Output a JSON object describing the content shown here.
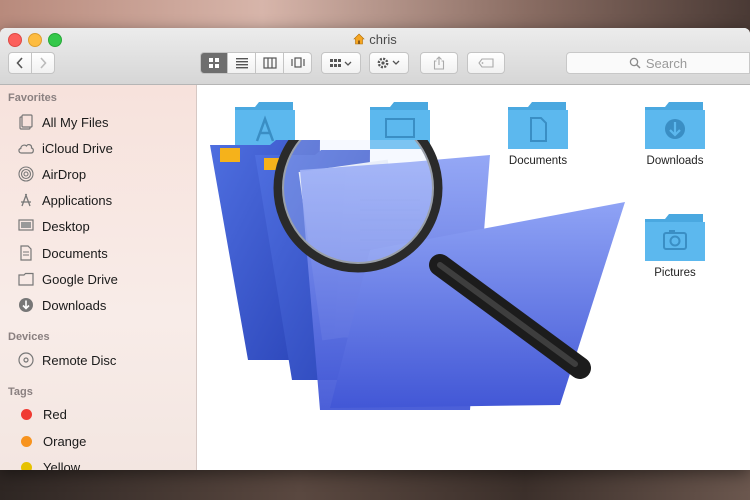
{
  "window": {
    "title": "chris"
  },
  "toolbar": {
    "search_placeholder": "Search"
  },
  "sidebar": {
    "sections": [
      {
        "header": "Favorites",
        "items": [
          {
            "label": "All My Files",
            "icon": "all-files-icon"
          },
          {
            "label": "iCloud Drive",
            "icon": "cloud-icon"
          },
          {
            "label": "AirDrop",
            "icon": "airdrop-icon"
          },
          {
            "label": "Applications",
            "icon": "applications-icon"
          },
          {
            "label": "Desktop",
            "icon": "desktop-icon"
          },
          {
            "label": "Documents",
            "icon": "document-icon"
          },
          {
            "label": "Google Drive",
            "icon": "folder-icon"
          },
          {
            "label": "Downloads",
            "icon": "download-icon"
          }
        ]
      },
      {
        "header": "Devices",
        "items": [
          {
            "label": "Remote Disc",
            "icon": "disc-icon"
          }
        ]
      },
      {
        "header": "Tags",
        "items": [
          {
            "label": "Red",
            "color": "#f03a32"
          },
          {
            "label": "Orange",
            "color": "#f7931e"
          },
          {
            "label": "Yellow",
            "color": "#e6c200"
          }
        ]
      }
    ]
  },
  "content": {
    "folders": [
      {
        "label": "",
        "icon": "applications-folder-icon"
      },
      {
        "label": "",
        "icon": "desktop-folder-icon"
      },
      {
        "label": "Documents",
        "icon": "documents-folder-icon"
      },
      {
        "label": "Downloads",
        "icon": "downloads-folder-icon"
      },
      {
        "label": "Pictures",
        "icon": "pictures-folder-icon"
      }
    ]
  },
  "colors": {
    "folder_blue": "#5cb8ee",
    "sidebar_bg": "#f7e2dc"
  }
}
